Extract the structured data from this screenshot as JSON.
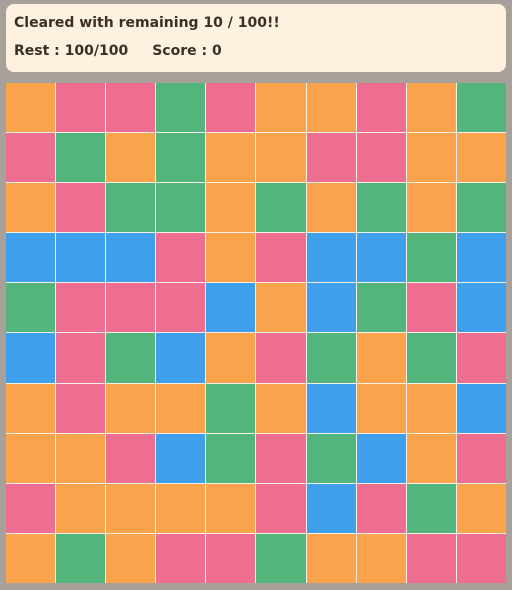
{
  "status": {
    "message": "Cleared with remaining 10 / 100!!",
    "rest_text": "Rest : 100/100",
    "score_text": "Score : 0"
  },
  "colors": {
    "O": "#f9a34c",
    "P": "#ee6e91",
    "G": "#52b57c",
    "B": "#3f9fea"
  },
  "board": [
    [
      "O",
      "P",
      "P",
      "G",
      "P",
      "O",
      "O",
      "P",
      "O",
      "G"
    ],
    [
      "P",
      "G",
      "O",
      "G",
      "O",
      "O",
      "P",
      "P",
      "O",
      "O"
    ],
    [
      "O",
      "P",
      "G",
      "G",
      "O",
      "G",
      "O",
      "G",
      "O",
      "G"
    ],
    [
      "B",
      "B",
      "B",
      "P",
      "O",
      "P",
      "B",
      "B",
      "G",
      "B"
    ],
    [
      "G",
      "P",
      "P",
      "P",
      "B",
      "O",
      "B",
      "G",
      "P",
      "B"
    ],
    [
      "B",
      "P",
      "G",
      "B",
      "O",
      "P",
      "G",
      "O",
      "G",
      "P"
    ],
    [
      "O",
      "P",
      "O",
      "O",
      "G",
      "O",
      "B",
      "O",
      "O",
      "B"
    ],
    [
      "O",
      "O",
      "P",
      "B",
      "G",
      "P",
      "G",
      "B",
      "O",
      "P"
    ],
    [
      "P",
      "O",
      "O",
      "O",
      "O",
      "P",
      "B",
      "P",
      "G",
      "O"
    ],
    [
      "O",
      "G",
      "O",
      "P",
      "P",
      "G",
      "O",
      "O",
      "P",
      "P"
    ]
  ]
}
